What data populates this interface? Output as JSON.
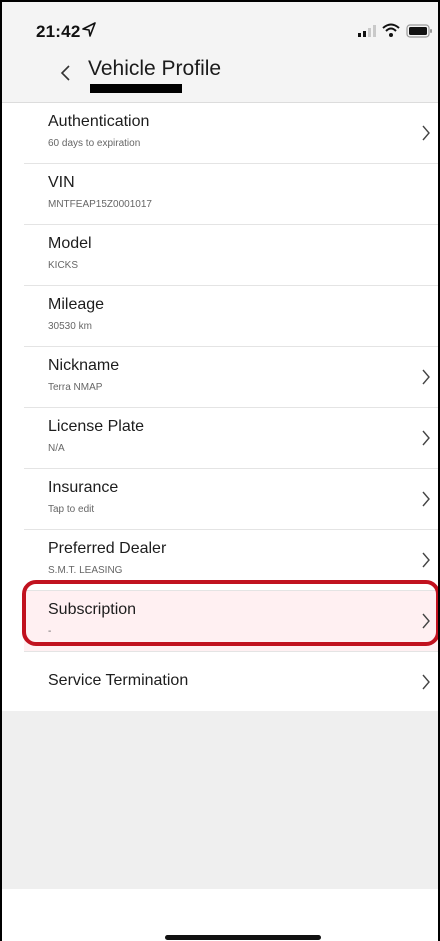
{
  "status_bar": {
    "time": "21:42",
    "icons": [
      "location-arrow-icon",
      "signal-icon",
      "wifi-icon",
      "battery-icon"
    ]
  },
  "nav": {
    "back_icon": "chevron-left-icon",
    "title": "Vehicle Profile"
  },
  "rows": [
    {
      "label": "Authentication",
      "sub": "60 days to expiration",
      "chevron": true
    },
    {
      "label": "VIN",
      "sub": "MNTFEAP15Z0001017",
      "chevron": false
    },
    {
      "label": "Model",
      "sub": "KICKS",
      "chevron": false
    },
    {
      "label": "Mileage",
      "sub": "30530 km",
      "chevron": false
    },
    {
      "label": "Nickname",
      "sub": "Terra NMAP",
      "chevron": true
    },
    {
      "label": "License Plate",
      "sub": "N/A",
      "chevron": true
    },
    {
      "label": "Insurance",
      "sub": "Tap to edit",
      "chevron": true
    },
    {
      "label": "Preferred Dealer",
      "sub": "S.M.T. LEASING",
      "chevron": true
    },
    {
      "label": "Subscription",
      "sub": "-",
      "chevron": true
    },
    {
      "label": "Service Termination",
      "sub": "",
      "chevron": true
    }
  ],
  "colors": {
    "highlight_ring": "#c1121f",
    "highlight_bg": "#fff0f2",
    "background": "#efefef"
  }
}
